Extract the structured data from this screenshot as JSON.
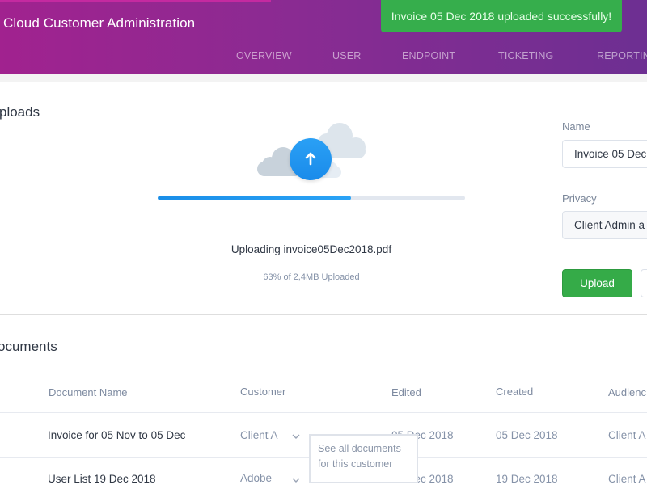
{
  "header": {
    "app_title": "Cloud Customer Administration",
    "nav": [
      {
        "label": "OVERVIEW"
      },
      {
        "label": "USER"
      },
      {
        "label": "ENDPOINT"
      },
      {
        "label": "TICKETING"
      },
      {
        "label": "REPORTIN"
      }
    ]
  },
  "toast": {
    "message": "Invoice 05 Dec 2018 uploaded successfully!",
    "color": "#36ae4c"
  },
  "uploads": {
    "title": "ploads",
    "icon": "cloud-upload-icon",
    "progress_percent": 63,
    "filename_text": "Uploading invoice05Dec2018.pdf",
    "status_text": "63% of 2,4MB Uploaded",
    "accent_color": "#1a8ee8"
  },
  "form": {
    "name_label": "Name",
    "name_value": "Invoice 05 Dec",
    "privacy_label": "Privacy",
    "privacy_value": "Client Admin a",
    "upload_button": "Upload",
    "upload_button_color": "#35ab48"
  },
  "documents": {
    "title": "ocuments",
    "columns": [
      "Document Name",
      "Customer",
      "Edited",
      "Created",
      "Audienc"
    ],
    "rows": [
      {
        "name": "Invoice for 05 Nov to 05 Dec",
        "customer": "Client A",
        "edited": "05 Dec 2018",
        "created": "05 Dec 2018",
        "audience": "Client A"
      },
      {
        "name": "User List 19 Dec 2018",
        "customer": "Adobe",
        "edited": "19 Dec 2018",
        "created": "19 Dec 2018",
        "audience": "Client A"
      }
    ],
    "tooltip_line1": "See all documents",
    "tooltip_line2": "for this customer"
  }
}
